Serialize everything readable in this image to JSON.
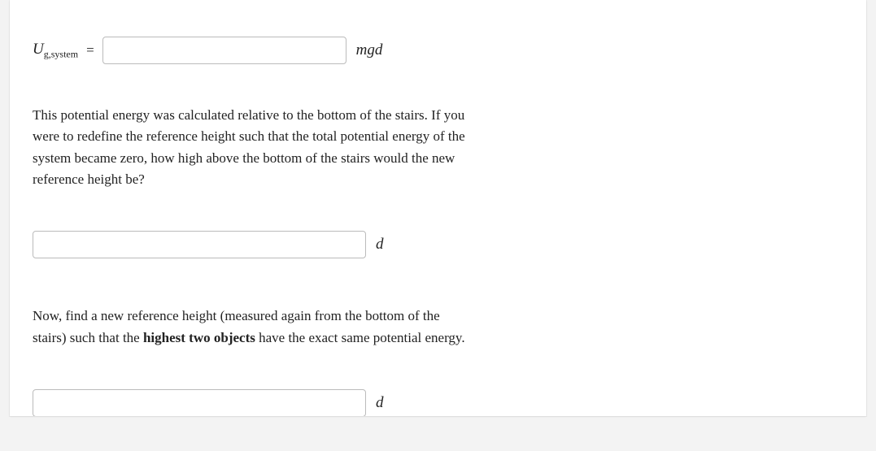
{
  "q1": {
    "variable_main": "U",
    "variable_sub": "g,system",
    "equals": "=",
    "unit": "mgd"
  },
  "q2": {
    "text": "This potential energy was calculated relative to the bottom of the stairs. If you were to redefine the reference height such that the total potential energy of the system became zero, how high above the bottom of the stairs would the new reference height be?",
    "unit": "d"
  },
  "q3": {
    "text_before": "Now, find a new reference height (measured again from the bottom of the stairs) such that the ",
    "text_bold": "highest two objects",
    "text_after": " have the exact same potential energy.",
    "unit": "d"
  }
}
